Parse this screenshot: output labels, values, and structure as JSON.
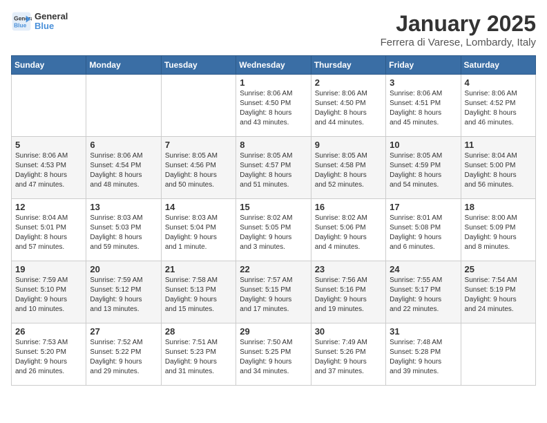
{
  "header": {
    "logo": {
      "line1": "General",
      "line2": "Blue"
    },
    "title": "January 2025",
    "subtitle": "Ferrera di Varese, Lombardy, Italy"
  },
  "days_of_week": [
    "Sunday",
    "Monday",
    "Tuesday",
    "Wednesday",
    "Thursday",
    "Friday",
    "Saturday"
  ],
  "weeks": [
    [
      {
        "day": "",
        "info": ""
      },
      {
        "day": "",
        "info": ""
      },
      {
        "day": "",
        "info": ""
      },
      {
        "day": "1",
        "info": "Sunrise: 8:06 AM\nSunset: 4:50 PM\nDaylight: 8 hours\nand 43 minutes."
      },
      {
        "day": "2",
        "info": "Sunrise: 8:06 AM\nSunset: 4:50 PM\nDaylight: 8 hours\nand 44 minutes."
      },
      {
        "day": "3",
        "info": "Sunrise: 8:06 AM\nSunset: 4:51 PM\nDaylight: 8 hours\nand 45 minutes."
      },
      {
        "day": "4",
        "info": "Sunrise: 8:06 AM\nSunset: 4:52 PM\nDaylight: 8 hours\nand 46 minutes."
      }
    ],
    [
      {
        "day": "5",
        "info": "Sunrise: 8:06 AM\nSunset: 4:53 PM\nDaylight: 8 hours\nand 47 minutes."
      },
      {
        "day": "6",
        "info": "Sunrise: 8:06 AM\nSunset: 4:54 PM\nDaylight: 8 hours\nand 48 minutes."
      },
      {
        "day": "7",
        "info": "Sunrise: 8:05 AM\nSunset: 4:56 PM\nDaylight: 8 hours\nand 50 minutes."
      },
      {
        "day": "8",
        "info": "Sunrise: 8:05 AM\nSunset: 4:57 PM\nDaylight: 8 hours\nand 51 minutes."
      },
      {
        "day": "9",
        "info": "Sunrise: 8:05 AM\nSunset: 4:58 PM\nDaylight: 8 hours\nand 52 minutes."
      },
      {
        "day": "10",
        "info": "Sunrise: 8:05 AM\nSunset: 4:59 PM\nDaylight: 8 hours\nand 54 minutes."
      },
      {
        "day": "11",
        "info": "Sunrise: 8:04 AM\nSunset: 5:00 PM\nDaylight: 8 hours\nand 56 minutes."
      }
    ],
    [
      {
        "day": "12",
        "info": "Sunrise: 8:04 AM\nSunset: 5:01 PM\nDaylight: 8 hours\nand 57 minutes."
      },
      {
        "day": "13",
        "info": "Sunrise: 8:03 AM\nSunset: 5:03 PM\nDaylight: 8 hours\nand 59 minutes."
      },
      {
        "day": "14",
        "info": "Sunrise: 8:03 AM\nSunset: 5:04 PM\nDaylight: 9 hours\nand 1 minute."
      },
      {
        "day": "15",
        "info": "Sunrise: 8:02 AM\nSunset: 5:05 PM\nDaylight: 9 hours\nand 3 minutes."
      },
      {
        "day": "16",
        "info": "Sunrise: 8:02 AM\nSunset: 5:06 PM\nDaylight: 9 hours\nand 4 minutes."
      },
      {
        "day": "17",
        "info": "Sunrise: 8:01 AM\nSunset: 5:08 PM\nDaylight: 9 hours\nand 6 minutes."
      },
      {
        "day": "18",
        "info": "Sunrise: 8:00 AM\nSunset: 5:09 PM\nDaylight: 9 hours\nand 8 minutes."
      }
    ],
    [
      {
        "day": "19",
        "info": "Sunrise: 7:59 AM\nSunset: 5:10 PM\nDaylight: 9 hours\nand 10 minutes."
      },
      {
        "day": "20",
        "info": "Sunrise: 7:59 AM\nSunset: 5:12 PM\nDaylight: 9 hours\nand 13 minutes."
      },
      {
        "day": "21",
        "info": "Sunrise: 7:58 AM\nSunset: 5:13 PM\nDaylight: 9 hours\nand 15 minutes."
      },
      {
        "day": "22",
        "info": "Sunrise: 7:57 AM\nSunset: 5:15 PM\nDaylight: 9 hours\nand 17 minutes."
      },
      {
        "day": "23",
        "info": "Sunrise: 7:56 AM\nSunset: 5:16 PM\nDaylight: 9 hours\nand 19 minutes."
      },
      {
        "day": "24",
        "info": "Sunrise: 7:55 AM\nSunset: 5:17 PM\nDaylight: 9 hours\nand 22 minutes."
      },
      {
        "day": "25",
        "info": "Sunrise: 7:54 AM\nSunset: 5:19 PM\nDaylight: 9 hours\nand 24 minutes."
      }
    ],
    [
      {
        "day": "26",
        "info": "Sunrise: 7:53 AM\nSunset: 5:20 PM\nDaylight: 9 hours\nand 26 minutes."
      },
      {
        "day": "27",
        "info": "Sunrise: 7:52 AM\nSunset: 5:22 PM\nDaylight: 9 hours\nand 29 minutes."
      },
      {
        "day": "28",
        "info": "Sunrise: 7:51 AM\nSunset: 5:23 PM\nDaylight: 9 hours\nand 31 minutes."
      },
      {
        "day": "29",
        "info": "Sunrise: 7:50 AM\nSunset: 5:25 PM\nDaylight: 9 hours\nand 34 minutes."
      },
      {
        "day": "30",
        "info": "Sunrise: 7:49 AM\nSunset: 5:26 PM\nDaylight: 9 hours\nand 37 minutes."
      },
      {
        "day": "31",
        "info": "Sunrise: 7:48 AM\nSunset: 5:28 PM\nDaylight: 9 hours\nand 39 minutes."
      },
      {
        "day": "",
        "info": ""
      }
    ]
  ]
}
